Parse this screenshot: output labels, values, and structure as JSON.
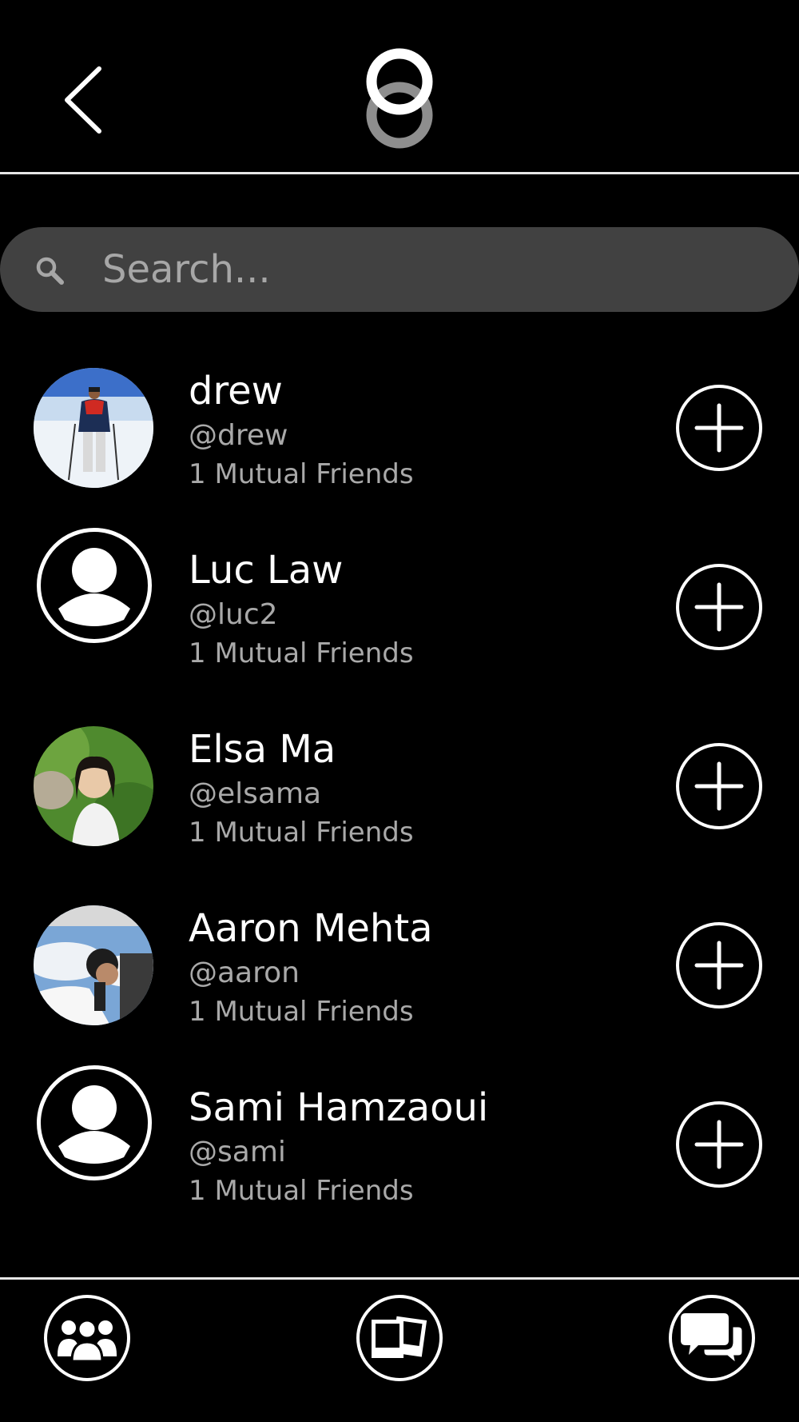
{
  "search": {
    "placeholder": "Search..."
  },
  "users": [
    {
      "name": "drew",
      "handle": "@drew",
      "mutual": "1 Mutual Friends",
      "avatar": "photo-snow"
    },
    {
      "name": "Luc Law",
      "handle": "@luc2",
      "mutual": "1 Mutual Friends",
      "avatar": "default-avatar-icon"
    },
    {
      "name": "Elsa Ma",
      "handle": "@elsama",
      "mutual": "1 Mutual Friends",
      "avatar": "photo-grass"
    },
    {
      "name": "Aaron Mehta",
      "handle": "@aaron",
      "mutual": "1 Mutual Friends",
      "avatar": "photo-sky"
    },
    {
      "name": "Sami Hamzaoui",
      "handle": "@sami",
      "mutual": "1 Mutual Friends",
      "avatar": "default-avatar-icon"
    }
  ],
  "nav": {
    "left": "friends-icon",
    "center": "photos-icon",
    "right": "chat-icon"
  },
  "colors": {
    "background": "#000000",
    "search_bg": "#414141",
    "secondary_text": "#a9a9a9",
    "foreground": "#ffffff"
  }
}
